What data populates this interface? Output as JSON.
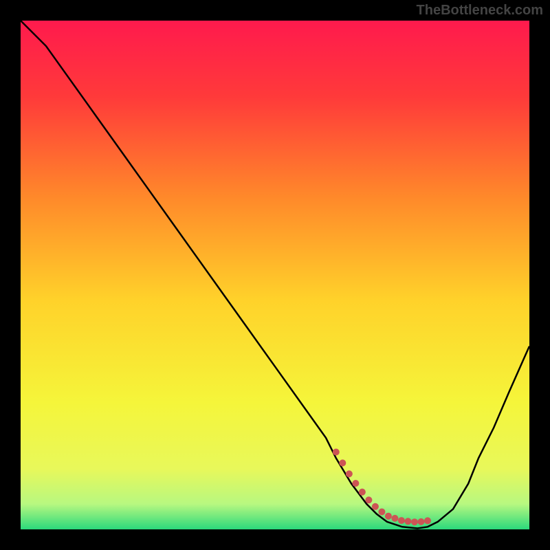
{
  "watermark": "TheBottleneck.com",
  "chart_data": {
    "type": "line",
    "title": "",
    "xlabel": "",
    "ylabel": "",
    "xlim": [
      0,
      100
    ],
    "ylim": [
      0,
      100
    ],
    "grid": false,
    "curve": {
      "name": "bottleneck-curve",
      "color": "#000000",
      "x": [
        0,
        5,
        10,
        15,
        20,
        25,
        30,
        35,
        40,
        45,
        50,
        55,
        60,
        62,
        65,
        68,
        70,
        72,
        75,
        78,
        80,
        82,
        85,
        88,
        90,
        93,
        96,
        100
      ],
      "y": [
        100,
        95,
        88,
        81,
        74,
        67,
        60,
        53,
        46,
        39,
        32,
        25,
        18,
        14,
        9,
        5,
        3,
        1.5,
        0.5,
        0.2,
        0.5,
        1.5,
        4,
        9,
        14,
        20,
        27,
        36
      ]
    },
    "highlight_band": {
      "name": "optimal-range",
      "color": "#cc5555",
      "x": [
        62,
        80
      ],
      "y": [
        2.5,
        2.5
      ]
    },
    "background_gradient": {
      "stops": [
        {
          "offset": 0.0,
          "color": "#ff1a4d"
        },
        {
          "offset": 0.15,
          "color": "#ff3a3a"
        },
        {
          "offset": 0.35,
          "color": "#ff8a2a"
        },
        {
          "offset": 0.55,
          "color": "#ffd22a"
        },
        {
          "offset": 0.75,
          "color": "#f5f53a"
        },
        {
          "offset": 0.88,
          "color": "#e8f85a"
        },
        {
          "offset": 0.95,
          "color": "#b8f880"
        },
        {
          "offset": 1.0,
          "color": "#2bd97c"
        }
      ]
    }
  }
}
